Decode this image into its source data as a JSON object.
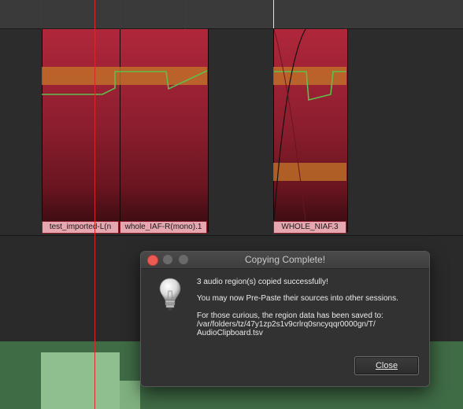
{
  "regions": [
    {
      "label": "test_imported-L(n"
    },
    {
      "label": "whole_IAF-R(mono).1"
    },
    {
      "label": "WHOLE_NIAF.3"
    }
  ],
  "dialog": {
    "title": "Copying Complete!",
    "message_line1": "3 audio region(s) copied successfully!",
    "message_line2": "You may now Pre-Paste their sources into other sessions.",
    "message_line3a": "For those curious, the region data has been saved to:",
    "message_line3b": "/var/folders/tz/47y1zp2s1v9crlrq0sncyqqr0000gn/T/",
    "message_line3c": "AudioClipboard.tsv",
    "close_label": "Close"
  },
  "colors": {
    "region": "#8d1e2f",
    "region_label_bg": "#e7a7b0",
    "gain_band": "#c47828",
    "automation_line": "#5dbf4d",
    "playhead": "#d5282b",
    "track_green": "#3f6b45",
    "close_dot": "#ec5b53"
  },
  "icons": {
    "dialog_icon": "lightbulb-icon"
  }
}
